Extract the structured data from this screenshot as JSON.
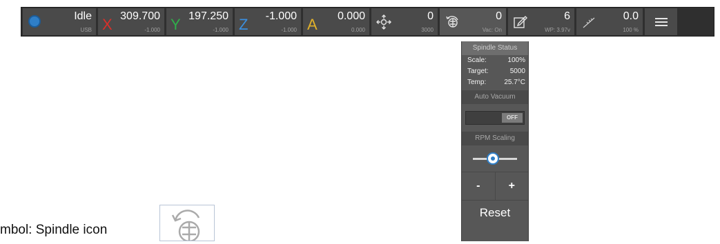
{
  "toolbar": {
    "status": {
      "value": "Idle",
      "sub": "USB",
      "icon": "status-dot-icon",
      "color": "#2f7fc8"
    },
    "x": {
      "letter": "X",
      "value": "309.700",
      "sub": "-1.000",
      "color": "#d9302a"
    },
    "y": {
      "letter": "Y",
      "value": "197.250",
      "sub": "-1.000",
      "color": "#2fae4a"
    },
    "z": {
      "letter": "Z",
      "value": "-1.000",
      "sub": "-1.000",
      "color": "#3b8fe0"
    },
    "a": {
      "letter": "A",
      "value": "0.000",
      "sub": "0.000",
      "color": "#e0b02a"
    },
    "jog": {
      "value": "0",
      "sub": "3000",
      "icon": "move-arrows-icon"
    },
    "spindle": {
      "value": "0",
      "sub": "Vac: On",
      "icon": "spindle-icon"
    },
    "tool": {
      "value": "6",
      "sub": "WP: 3.97v",
      "icon": "tool-edit-icon"
    },
    "feed": {
      "value": "0.0",
      "sub": "100 %",
      "icon": "feed-icon"
    },
    "menu": {
      "icon": "hamburger-menu-icon"
    }
  },
  "spindle_panel": {
    "header": "Spindle Status",
    "scale_label": "Scale:",
    "scale_value": "100%",
    "target_label": "Target:",
    "target_value": "5000",
    "temp_label": "Temp:",
    "temp_value": "25.7°C",
    "auto_vacuum_header": "Auto Vacuum",
    "toggle_state": "OFF",
    "rpm_scaling_header": "RPM Scaling",
    "minus": "-",
    "plus": "+",
    "reset": "Reset"
  },
  "caption": {
    "text": "mbol: Spindle icon"
  }
}
